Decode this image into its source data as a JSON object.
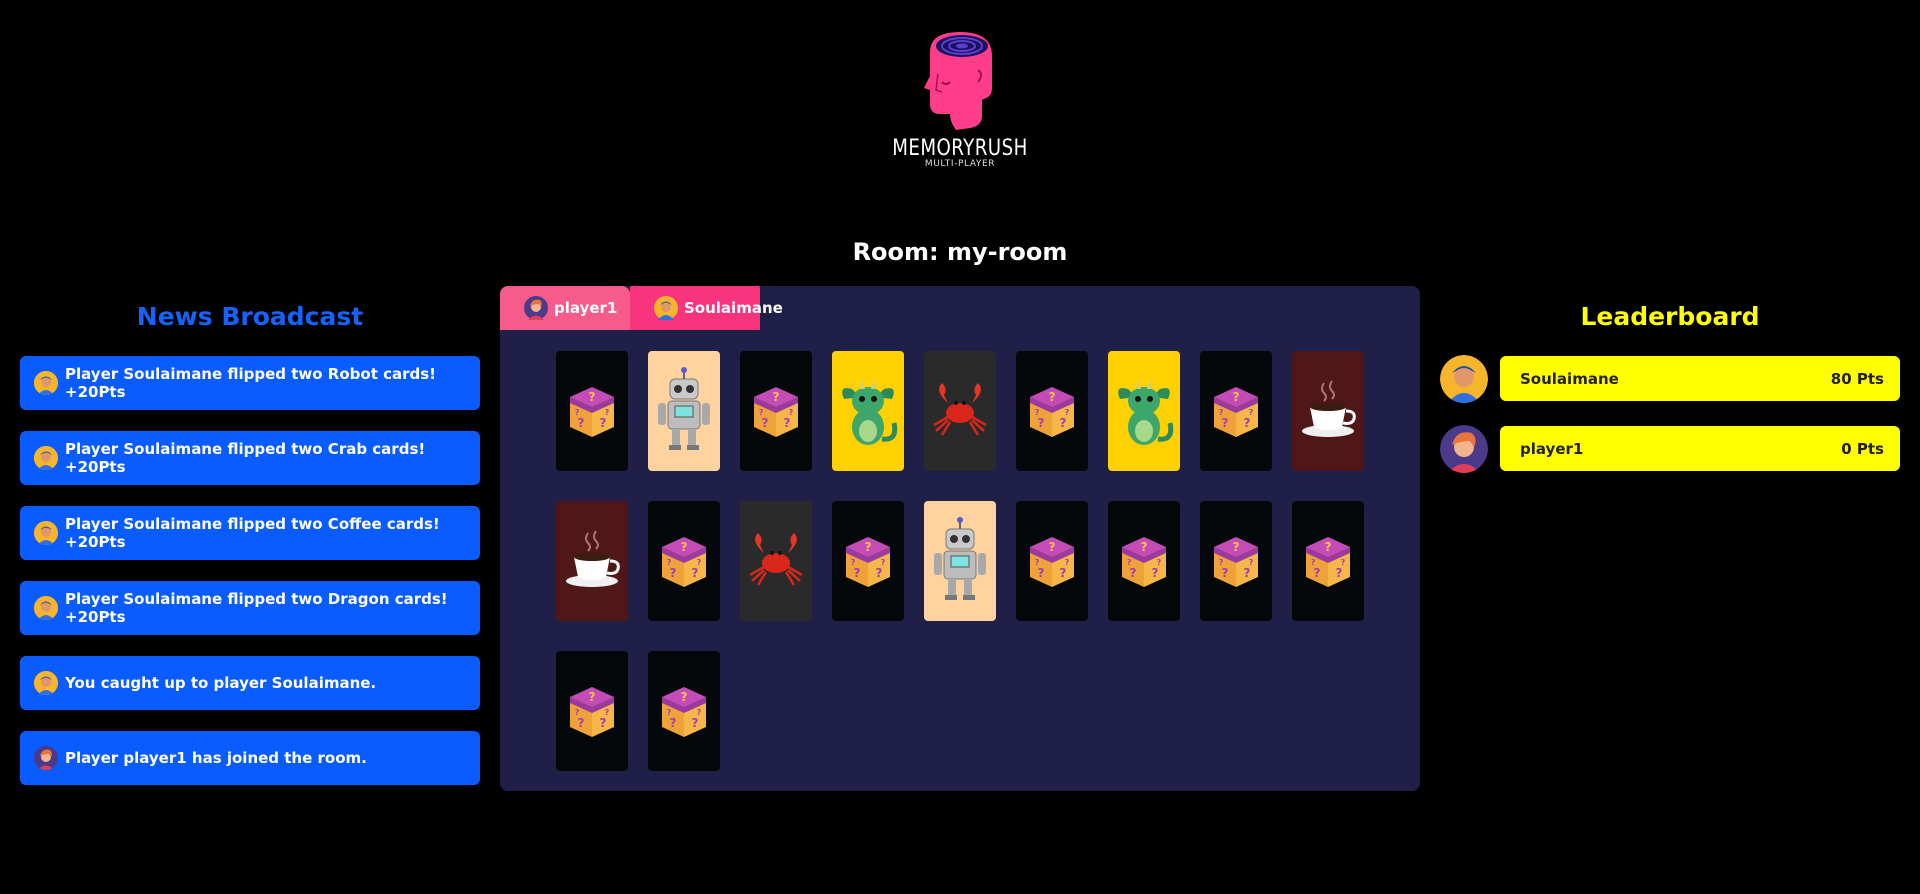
{
  "app": {
    "logo_title": "MEMORYRUSH",
    "logo_subtitle": "MULTI-PLAYER",
    "logo_icon": "head-spiral-icon",
    "brand_pink": "#ff3d8b"
  },
  "room": {
    "title": "Room: my-room"
  },
  "news": {
    "title": "News Broadcast",
    "items": [
      {
        "text": "Player Soulaimane flipped two Robot cards! +20Pts",
        "avatar": "soulaimane"
      },
      {
        "text": "Player Soulaimane flipped two Crab cards! +20Pts",
        "avatar": "soulaimane"
      },
      {
        "text": "Player Soulaimane flipped two Coffee cards! +20Pts",
        "avatar": "soulaimane"
      },
      {
        "text": "Player Soulaimane flipped two Dragon cards! +20Pts",
        "avatar": "soulaimane"
      },
      {
        "text": "You caught up to player Soulaimane.",
        "avatar": "soulaimane"
      },
      {
        "text": "Player player1 has joined the room.",
        "avatar": "player1"
      }
    ]
  },
  "tabs": [
    {
      "label": "player1",
      "avatar": "player1"
    },
    {
      "label": "Soulaimane",
      "avatar": "soulaimane"
    }
  ],
  "board": {
    "cards": [
      "hidden",
      "robot",
      "hidden",
      "dragon",
      "crab",
      "hidden",
      "dragon",
      "hidden",
      "coffee",
      "coffee",
      "hidden",
      "crab",
      "hidden",
      "robot",
      "hidden",
      "hidden",
      "hidden",
      "hidden",
      "hidden",
      "hidden"
    ],
    "card_colors": {
      "hidden": "#05080a",
      "robot": "#ffd3a0",
      "dragon": "#ffd100",
      "crab": "#2a2a2a",
      "coffee": "#4f1717"
    }
  },
  "leaderboard": {
    "title": "Leaderboard",
    "rows": [
      {
        "name": "Soulaimane",
        "points": "80 Pts",
        "avatar": "soulaimane"
      },
      {
        "name": "player1",
        "points": "0 Pts",
        "avatar": "player1"
      }
    ]
  }
}
